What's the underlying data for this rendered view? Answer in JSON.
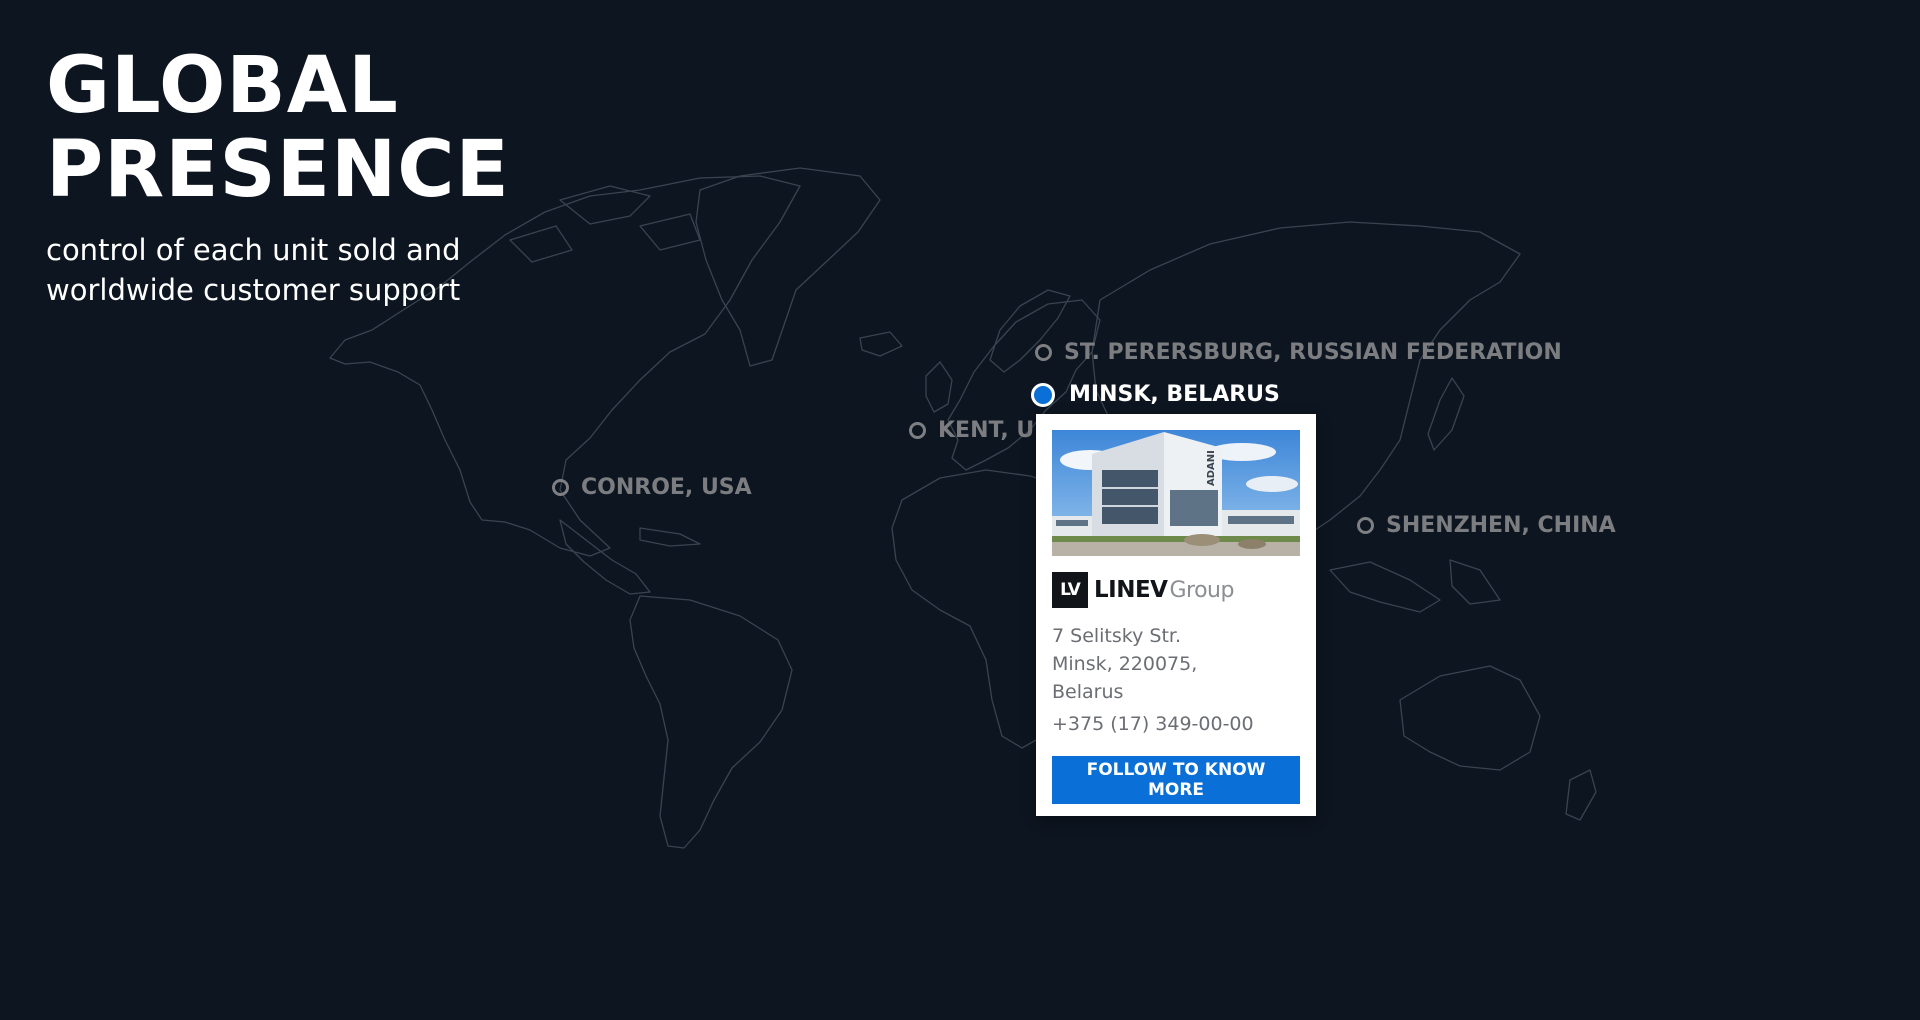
{
  "hero": {
    "title": "GLOBAL PRESENCE",
    "subtitle": "control of each unit sold and worldwide customer support"
  },
  "locations": [
    {
      "label": "ST. PERERSBURG, RUSSIAN FEDERATION",
      "active": false
    },
    {
      "label": "MINSK, BELARUS",
      "active": true
    },
    {
      "label": "KENT, UNITED KINGDOM",
      "active": false
    },
    {
      "label": "CONROE, USA",
      "active": false
    },
    {
      "label": "SHENZHEN, CHINA",
      "active": false
    }
  ],
  "card": {
    "photo_alt": "Office building",
    "photo_sign": "ADANI",
    "logo_mark": "LV",
    "logo_word": "LINEV",
    "logo_group": "Group",
    "address_line1": "7 Selitsky Str.",
    "address_line2": "Minsk, 220075,",
    "address_line3": "Belarus",
    "phone": "+375 (17) 349-00-00",
    "button_label": "FOLLOW TO KNOW MORE"
  },
  "colors": {
    "background": "#0d1520",
    "map_outline": "#3a4350",
    "accent": "#0a6fd6",
    "inactive_label": "#7c7d80"
  }
}
